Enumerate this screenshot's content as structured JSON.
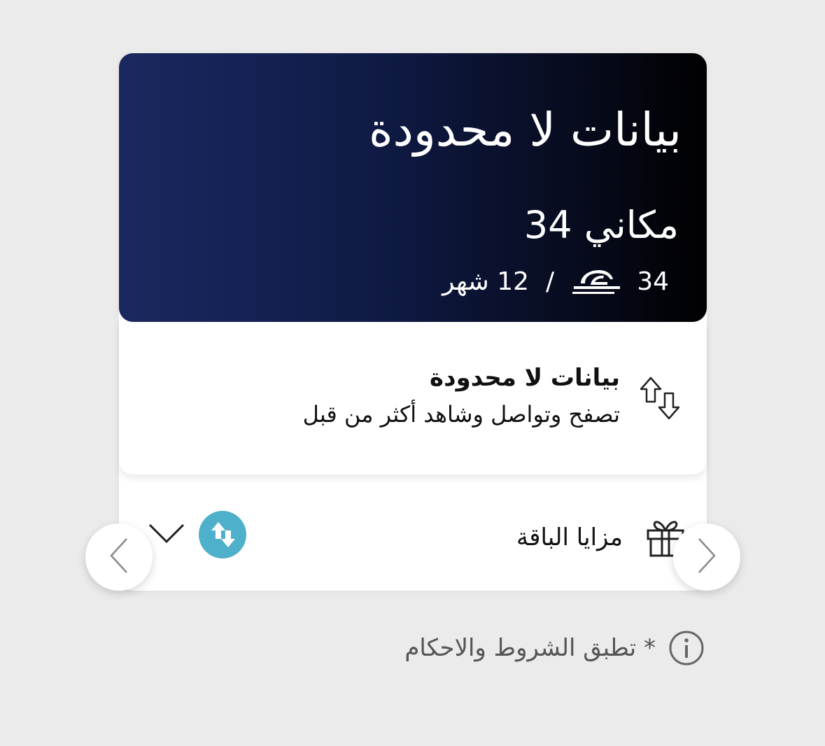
{
  "plan_card": {
    "title": "بيانات لا محدودة",
    "plan_name": "مكاني 34",
    "price_amount": "34",
    "price_separator": "/",
    "duration": "12 شهر",
    "currency_icon": "riyal-currency-icon",
    "gradient_colors": [
      "#1a2860",
      "#000000"
    ]
  },
  "feature": {
    "icon": "data-transfer-arrows-icon",
    "title": "بيانات لا محدودة",
    "description": "تصفح وتواصل وشاهد أكثر من قبل"
  },
  "benefits": {
    "icon": "gift-icon",
    "label": "مزايا الباقة",
    "badge_icon": "swap-arrows-icon",
    "badge_color": "#4fb0cc",
    "toggle_icon": "chevron-down-icon"
  },
  "carousel": {
    "prev_icon": "chevron-left-icon",
    "next_icon": "chevron-right-icon"
  },
  "terms": {
    "icon": "info-icon",
    "text": "* تطبق الشروط والاحكام"
  }
}
